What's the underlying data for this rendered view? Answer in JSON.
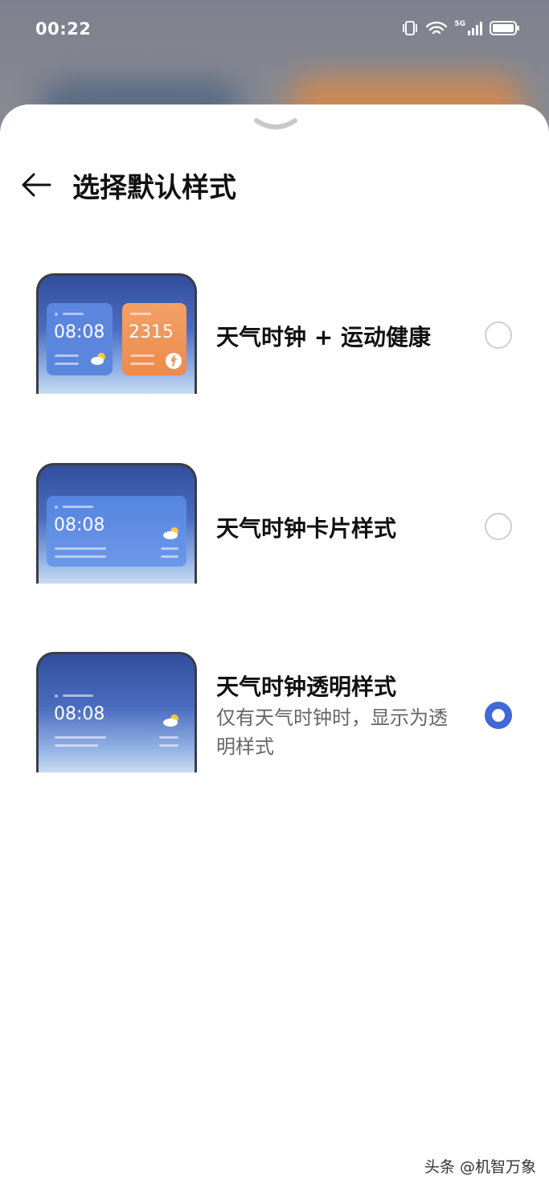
{
  "status_bar": {
    "time": "00:22",
    "network_label": "5G",
    "icons": [
      "vibrate-icon",
      "wifi-icon",
      "cellular-signal-icon",
      "battery-icon"
    ]
  },
  "sheet": {
    "title": "选择默认样式",
    "options": [
      {
        "title": "天气时钟 + 运动健康",
        "subtitle": "",
        "selected": false,
        "preview": {
          "clock": "08:08",
          "steps": "2315"
        }
      },
      {
        "title": "天气时钟卡片样式",
        "subtitle": "",
        "selected": false,
        "preview": {
          "clock": "08:08"
        }
      },
      {
        "title": "天气时钟透明样式",
        "subtitle": "仅有天气时钟时，显示为透明样式",
        "selected": true,
        "preview": {
          "clock": "08:08"
        }
      }
    ]
  },
  "watermark": "头条 @机智万象",
  "colors": {
    "accent": "#3f68d8",
    "steps_card": "#f0925a",
    "weather_card": "#5a86de"
  }
}
